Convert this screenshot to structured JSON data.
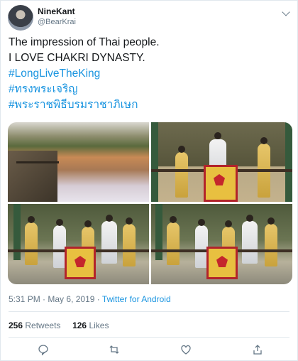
{
  "author": {
    "name": "NineKant",
    "handle": "@BearKrai"
  },
  "tweet": {
    "lines": [
      "The impression of Thai people.",
      "I LOVE CHAKRI DYNASTY.",
      "#LongLiveTheKing",
      "#ทรงพระเจริญ",
      "#พระราชพิธีบรมราชาภิเษก"
    ]
  },
  "meta": {
    "time": "5:31 PM",
    "sep": "·",
    "date": "May 6, 2019",
    "source": "Twitter for Android"
  },
  "stats": {
    "retweets_count": "256",
    "retweets_label": "Retweets",
    "likes_count": "126",
    "likes_label": "Likes"
  },
  "colors": {
    "link": "#1b95e0",
    "muted": "#657786",
    "text": "#14171a"
  },
  "icons": [
    "chevron-down-icon",
    "reply-icon",
    "retweet-icon",
    "like-icon",
    "share-icon"
  ]
}
